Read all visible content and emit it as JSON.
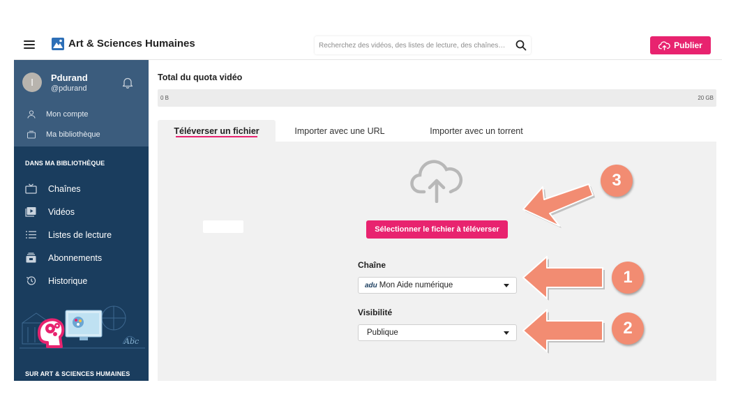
{
  "header": {
    "title": "Art & Sciences Humaines",
    "search_placeholder": "Recherchez des vidéos, des listes de lecture, des chaînes…",
    "publish_label": "Publier"
  },
  "user": {
    "avatar_initial": "l",
    "name": "Pdurand",
    "handle": "@pdurand",
    "links": [
      {
        "label": "Mon compte",
        "icon": "person-icon"
      },
      {
        "label": "Ma bibliothèque",
        "icon": "library-icon"
      }
    ]
  },
  "sidebar": {
    "library_title": "DANS MA BIBLIOTHÈQUE",
    "items": [
      {
        "label": "Chaînes",
        "icon": "tv-icon"
      },
      {
        "label": "Vidéos",
        "icon": "video-icon"
      },
      {
        "label": "Listes de lecture",
        "icon": "list-icon"
      },
      {
        "label": "Abonnements",
        "icon": "subscriptions-icon"
      },
      {
        "label": "Historique",
        "icon": "history-icon"
      }
    ],
    "footer_title": "SUR ART & SCIENCES HUMAINES"
  },
  "quota": {
    "title": "Total du quota vidéo",
    "min": "0 B",
    "max": "20 GB"
  },
  "tabs": [
    {
      "label": "Téléverser un fichier",
      "active": true
    },
    {
      "label": "Importer avec une URL",
      "active": false
    },
    {
      "label": "Importer avec un torrent",
      "active": false
    }
  ],
  "upload": {
    "select_file_label": "Sélectionner le fichier à téléverser",
    "channel_label": "Chaîne",
    "channel_logo": "adu",
    "channel_value": "Mon Aide numérique",
    "visibility_label": "Visibilité",
    "visibility_value": "Publique"
  },
  "annotations": [
    "1",
    "2",
    "3"
  ],
  "colors": {
    "accent": "#e8236f",
    "sidebar": "#1a3d5e",
    "sidebar_user": "#3b5c7d",
    "annotation": "#f28c72"
  }
}
